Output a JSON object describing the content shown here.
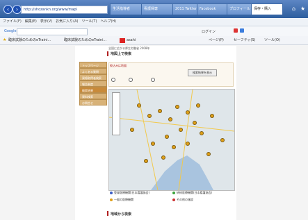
{
  "browser": {
    "address": "http://shozankn.org/www/mapl",
    "tabs": [
      "生活指導者",
      "看護婦専",
      "ツイッター",
      "2011 Twitter",
      "Facebook",
      "プロフィール",
      "保存・購入"
    ],
    "menu": "ファイル(F)　編集(E)　表示(V)　お気に入り(A)　ツール(T)　ヘルプ(H)",
    "search_label": "Google",
    "login_label": "ログイン",
    "page_menu": "ページ(P)",
    "safety_menu": "セーフティ(S)",
    "tools_menu": "ツール(O)",
    "favorites": [
      "臨床試験のためのeTraini...",
      "臨床試験のためのeTraini...",
      "asahi"
    ]
  },
  "site": {
    "header": "全国に広がる厚生労働省 2008年",
    "section_title": "地図上で検索",
    "sidebar": [
      "トップページ",
      "よくある質問",
      "資格取得者検索",
      "報告制度",
      "検索結果",
      "資料検索",
      "お問合せ"
    ],
    "form_title": "絞込みは地図",
    "search_button": "検索結果を表示",
    "footer_title": "地域から検索",
    "legend": [
      "登録医療機関(日本看護協会)",
      "研修医療機関(日本看護協会)",
      "一般の医療機関",
      "その他の施設"
    ]
  },
  "colors": {
    "accent": "#c88a3a",
    "pin": "#e0a019",
    "heading": "#b02020"
  }
}
